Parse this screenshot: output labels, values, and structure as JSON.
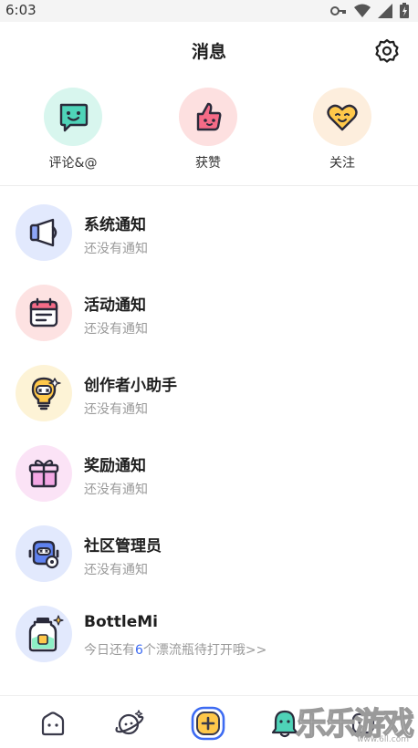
{
  "status_bar": {
    "time": "6:03"
  },
  "header": {
    "title": "消息"
  },
  "quick_actions": [
    {
      "label": "评论&@",
      "icon": "comment-icon",
      "bg": "#d8f6ee"
    },
    {
      "label": "获赞",
      "icon": "thumbs-up-icon",
      "bg": "#fde0e0"
    },
    {
      "label": "关注",
      "icon": "heart-icon",
      "bg": "#fdeedd"
    }
  ],
  "notices": [
    {
      "title": "系统通知",
      "subtitle": "还没有通知",
      "icon": "megaphone-icon",
      "bg": "#e2e9fd"
    },
    {
      "title": "活动通知",
      "subtitle": "还没有通知",
      "icon": "calendar-icon",
      "bg": "#fde2e2"
    },
    {
      "title": "创作者小助手",
      "subtitle": "还没有通知",
      "icon": "lightbulb-robot-icon",
      "bg": "#fdf3d6"
    },
    {
      "title": "奖励通知",
      "subtitle": "还没有通知",
      "icon": "gift-icon",
      "bg": "#fbe3f6"
    },
    {
      "title": "社区管理员",
      "subtitle": "还没有通知",
      "icon": "admin-robot-icon",
      "bg": "#e2e9fd"
    },
    {
      "title": "BottleMi",
      "subtitle_prefix": "今日还有",
      "subtitle_count": "6",
      "subtitle_suffix": "个漂流瓶待打开哦>>",
      "icon": "bottle-icon",
      "bg": "#e2e9fd"
    }
  ],
  "tabs": [
    {
      "icon": "home-icon"
    },
    {
      "icon": "planet-icon"
    },
    {
      "icon": "create-icon"
    },
    {
      "icon": "bell-icon",
      "active": true
    },
    {
      "icon": "profile-icon"
    }
  ],
  "watermark": {
    "text": "乐乐游戏",
    "url": "www.6ll.com"
  },
  "colors": {
    "accent": "#3d6bf2",
    "teal": "#4fd3b8",
    "pink": "#f56b87",
    "yellow": "#ffc84a"
  }
}
